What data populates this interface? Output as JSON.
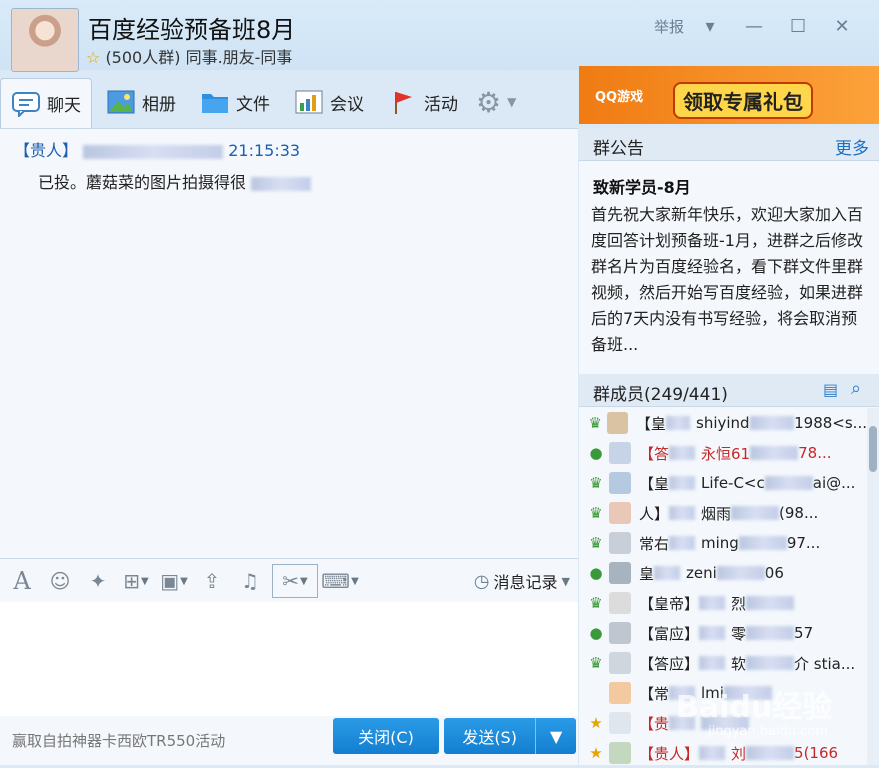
{
  "header": {
    "title": "百度经验预备班8月",
    "group_size": "(500人群)",
    "group_tags": "同事.朋友-同事",
    "report_label": "举报"
  },
  "tabs": [
    {
      "label": "聊天",
      "icon": "chat-icon"
    },
    {
      "label": "相册",
      "icon": "photo-icon"
    },
    {
      "label": "文件",
      "icon": "folder-icon"
    },
    {
      "label": "会议",
      "icon": "meeting-icon"
    },
    {
      "label": "活动",
      "icon": "flag-icon"
    }
  ],
  "banner": {
    "brand": "QQ游戏",
    "text": "领取专属礼包"
  },
  "chat": {
    "messages": [
      {
        "sender_tag": "【贵人】",
        "time": "21:15:33",
        "text": "已投。蘑菇菜的图片拍摄得很"
      }
    ]
  },
  "toolbar": {
    "history_label": "消息记录"
  },
  "footer": {
    "promo": "赢取自拍神器卡西欧TR550活动",
    "close_label": "关闭(C)",
    "send_label": "发送(S)"
  },
  "notice": {
    "label": "群公告",
    "more_label": "更多",
    "title": "致新学员-8月",
    "body": "首先祝大家新年快乐，欢迎大家加入百度回答计划预备班-1月，进群之后修改群名片为百度经验名，看下群文件里群视频，然后开始写百度经验，如果进群后的7天内没有书写经验，将会取消预备班..."
  },
  "members": {
    "label": "群成员(249/441)",
    "items": [
      {
        "tag": "【皇",
        "name": "shiyind",
        "tail": "1988<s...",
        "color": "#222",
        "status_icon": "crown-user-icon"
      },
      {
        "tag": "【答",
        "name": "永恒61",
        "tail": "78...",
        "color": "#c62828",
        "status_icon": "user-icon"
      },
      {
        "tag": "【皇",
        "name": "Life-C<c",
        "tail": "ai@...",
        "color": "#222",
        "status_icon": "crown-user-icon"
      },
      {
        "tag": "人】",
        "name": "烟雨",
        "tail": "(98...",
        "color": "#222",
        "status_icon": "crown-user-icon"
      },
      {
        "tag": "常右",
        "name": "ming",
        "tail": "97...",
        "color": "#222",
        "status_icon": "crown-user-icon"
      },
      {
        "tag": "皇",
        "name": "zeni",
        "tail": "06",
        "color": "#222",
        "status_icon": "user-icon"
      },
      {
        "tag": "【皇帝】",
        "name": "烈",
        "tail": "",
        "color": "#222",
        "status_icon": "crown-user-icon"
      },
      {
        "tag": "【富应】",
        "name": "零",
        "tail": "57",
        "color": "#222",
        "status_icon": "user-icon"
      },
      {
        "tag": "【答应】",
        "name": "软",
        "tail": "介 stia...",
        "color": "#222",
        "status_icon": "crown-user-icon"
      },
      {
        "tag": "【常",
        "name": "lmi",
        "tail": "",
        "color": "#222",
        "status_icon": "none"
      },
      {
        "tag": "【贵",
        "name": "",
        "tail": "",
        "color": "#c62828",
        "status_icon": "star-icon"
      },
      {
        "tag": "【贵人】",
        "name": "刘",
        "tail": "5(166",
        "color": "#c62828",
        "status_icon": "star-icon"
      }
    ]
  },
  "watermark": {
    "text": "Baidu经验",
    "sub": "jingyan.baidu.com"
  }
}
